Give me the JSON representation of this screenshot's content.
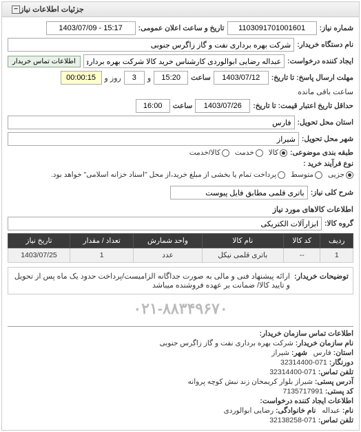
{
  "panel": {
    "title": "جزئیات اطلاعات نیاز"
  },
  "fields": {
    "request_no_label": "شماره نیاز:",
    "request_no": "1103091701001601",
    "announce_label": "تاریخ و ساعت اعلان عمومی:",
    "announce_value": "1403/07/09 - 15:17",
    "buyer_org_label": "نام دستگاه خریدار:",
    "buyer_org": "شرکت بهره برداری نفت و گاز زاگرس جنوبی",
    "creator_label": "ایجاد کننده درخواست:",
    "creator": "عبداله رضایی ابوالوردی کارشناس خرید کالا شرکت بهره برداری نفت و گاز زاگرس",
    "contact_btn": "اطلاعات تماس خریدار",
    "reply_deadline_label": "مهلت ارسال پاسخ: تا تاریخ:",
    "reply_date": "1403/07/12",
    "time_label": "ساعت",
    "reply_time": "15:20",
    "and_label": "و",
    "days_value": "3",
    "day_label": "روز و",
    "remain_value": "00:00:15",
    "remain_label": "ساعت باقی مانده",
    "validity_label": "حداقل تاریخ اعتبار قیمت: تا تاریخ:",
    "validity_date": "1403/07/26",
    "validity_time": "16:00",
    "province_label": "استان محل تحویل:",
    "province": "فارس",
    "city_label": "شهر محل تحویل:",
    "city": "شیراز",
    "category_label": "طبقه بندی موضوعی:",
    "cat_goods": "کالا",
    "cat_service": "خدمت",
    "cat_both": "کالا/خدمت",
    "process_label": "نوع فرآیند خرید :",
    "proc_minor": "جزیی",
    "proc_medium": "متوسط",
    "proc_note": "پرداخت تمام یا بخشی از مبلغ خرید،از محل \"اسناد خزانه اسلامی\" خواهد بود.",
    "general_desc_label": "شرح کلی نیاز:",
    "general_desc": "باتری قلمی مطابق فایل پیوست"
  },
  "goods_section": {
    "title": "اطلاعات کالاهای مورد نیاز",
    "group_label": "گروه کالا:",
    "group_value": "ابزارآلات الکتریکی"
  },
  "table": {
    "headers": {
      "row": "ردیف",
      "code": "کد کالا",
      "name": "نام کالا",
      "unit": "واحد شمارش",
      "qty": "تعداد / مقدار",
      "date": "تاریخ نیاز"
    },
    "rows": [
      {
        "row": "1",
        "code": "--",
        "name": "باتری قلمی نیکل",
        "unit": "عدد",
        "qty": "1",
        "date": "1403/07/25"
      }
    ]
  },
  "description": {
    "label": "توضیحات خریدار:",
    "text": "ارائه پیشنهاد فنی و مالی به صورت جداگانه الزامیست/پرداخت حدود یک ماه پس از تحویل و تایید کالا/ ضمانت بر عهده فروشنده میباشد"
  },
  "watermark": "۰۲۱-۸۸۳۴۹۶۷۰",
  "contact": {
    "title": "اطلاعات تماس سازمان خریدار:",
    "org_label": "نام سازمان خریدار:",
    "org": "شرکت بهره برداری نفت و گاز زاگرس جنوبی",
    "city_label": "شهر:",
    "city": "شیراز",
    "province_label": "استان:",
    "province": "فارس",
    "fax_label": "دورنگار:",
    "fax": "071-32314400",
    "phone_label": "تلفن تماس:",
    "phone": "071-32314400",
    "postal_addr_label": "آدرس پستی:",
    "postal_addr": "شیراز بلوار کریمخان زند نبش کوچه پروانه",
    "postal_code_label": "کد پستی:",
    "postal_code": "7135717991",
    "creator_section": "اطلاعات ایجاد کننده درخواست:",
    "name_label": "نام:",
    "name": "عبداله",
    "family_label": "نام خانوادگی:",
    "family": "رضایی ابوالوردی",
    "phone2_label": "تلفن تماس:",
    "phone2": "071-32138258"
  }
}
